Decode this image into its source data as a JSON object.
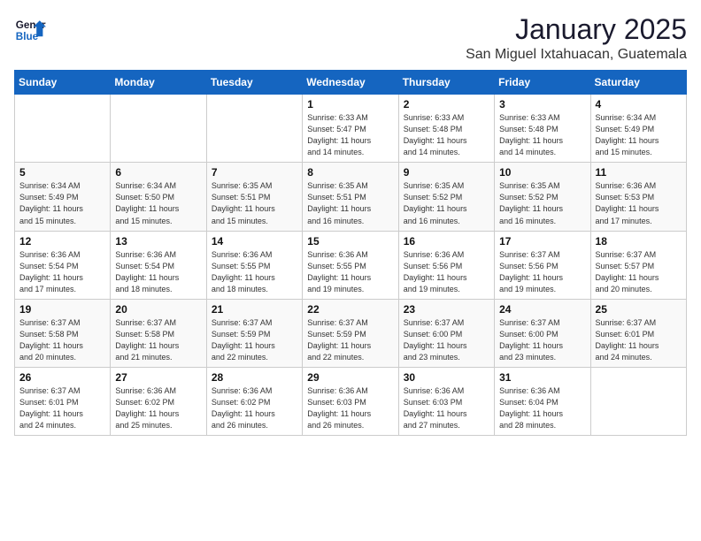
{
  "header": {
    "logo_line1": "General",
    "logo_line2": "Blue",
    "month_year": "January 2025",
    "location": "San Miguel Ixtahuacan, Guatemala"
  },
  "weekdays": [
    "Sunday",
    "Monday",
    "Tuesday",
    "Wednesday",
    "Thursday",
    "Friday",
    "Saturday"
  ],
  "weeks": [
    [
      {
        "day": "",
        "info": ""
      },
      {
        "day": "",
        "info": ""
      },
      {
        "day": "",
        "info": ""
      },
      {
        "day": "1",
        "info": "Sunrise: 6:33 AM\nSunset: 5:47 PM\nDaylight: 11 hours\nand 14 minutes."
      },
      {
        "day": "2",
        "info": "Sunrise: 6:33 AM\nSunset: 5:48 PM\nDaylight: 11 hours\nand 14 minutes."
      },
      {
        "day": "3",
        "info": "Sunrise: 6:33 AM\nSunset: 5:48 PM\nDaylight: 11 hours\nand 14 minutes."
      },
      {
        "day": "4",
        "info": "Sunrise: 6:34 AM\nSunset: 5:49 PM\nDaylight: 11 hours\nand 15 minutes."
      }
    ],
    [
      {
        "day": "5",
        "info": "Sunrise: 6:34 AM\nSunset: 5:49 PM\nDaylight: 11 hours\nand 15 minutes."
      },
      {
        "day": "6",
        "info": "Sunrise: 6:34 AM\nSunset: 5:50 PM\nDaylight: 11 hours\nand 15 minutes."
      },
      {
        "day": "7",
        "info": "Sunrise: 6:35 AM\nSunset: 5:51 PM\nDaylight: 11 hours\nand 15 minutes."
      },
      {
        "day": "8",
        "info": "Sunrise: 6:35 AM\nSunset: 5:51 PM\nDaylight: 11 hours\nand 16 minutes."
      },
      {
        "day": "9",
        "info": "Sunrise: 6:35 AM\nSunset: 5:52 PM\nDaylight: 11 hours\nand 16 minutes."
      },
      {
        "day": "10",
        "info": "Sunrise: 6:35 AM\nSunset: 5:52 PM\nDaylight: 11 hours\nand 16 minutes."
      },
      {
        "day": "11",
        "info": "Sunrise: 6:36 AM\nSunset: 5:53 PM\nDaylight: 11 hours\nand 17 minutes."
      }
    ],
    [
      {
        "day": "12",
        "info": "Sunrise: 6:36 AM\nSunset: 5:54 PM\nDaylight: 11 hours\nand 17 minutes."
      },
      {
        "day": "13",
        "info": "Sunrise: 6:36 AM\nSunset: 5:54 PM\nDaylight: 11 hours\nand 18 minutes."
      },
      {
        "day": "14",
        "info": "Sunrise: 6:36 AM\nSunset: 5:55 PM\nDaylight: 11 hours\nand 18 minutes."
      },
      {
        "day": "15",
        "info": "Sunrise: 6:36 AM\nSunset: 5:55 PM\nDaylight: 11 hours\nand 19 minutes."
      },
      {
        "day": "16",
        "info": "Sunrise: 6:36 AM\nSunset: 5:56 PM\nDaylight: 11 hours\nand 19 minutes."
      },
      {
        "day": "17",
        "info": "Sunrise: 6:37 AM\nSunset: 5:56 PM\nDaylight: 11 hours\nand 19 minutes."
      },
      {
        "day": "18",
        "info": "Sunrise: 6:37 AM\nSunset: 5:57 PM\nDaylight: 11 hours\nand 20 minutes."
      }
    ],
    [
      {
        "day": "19",
        "info": "Sunrise: 6:37 AM\nSunset: 5:58 PM\nDaylight: 11 hours\nand 20 minutes."
      },
      {
        "day": "20",
        "info": "Sunrise: 6:37 AM\nSunset: 5:58 PM\nDaylight: 11 hours\nand 21 minutes."
      },
      {
        "day": "21",
        "info": "Sunrise: 6:37 AM\nSunset: 5:59 PM\nDaylight: 11 hours\nand 22 minutes."
      },
      {
        "day": "22",
        "info": "Sunrise: 6:37 AM\nSunset: 5:59 PM\nDaylight: 11 hours\nand 22 minutes."
      },
      {
        "day": "23",
        "info": "Sunrise: 6:37 AM\nSunset: 6:00 PM\nDaylight: 11 hours\nand 23 minutes."
      },
      {
        "day": "24",
        "info": "Sunrise: 6:37 AM\nSunset: 6:00 PM\nDaylight: 11 hours\nand 23 minutes."
      },
      {
        "day": "25",
        "info": "Sunrise: 6:37 AM\nSunset: 6:01 PM\nDaylight: 11 hours\nand 24 minutes."
      }
    ],
    [
      {
        "day": "26",
        "info": "Sunrise: 6:37 AM\nSunset: 6:01 PM\nDaylight: 11 hours\nand 24 minutes."
      },
      {
        "day": "27",
        "info": "Sunrise: 6:36 AM\nSunset: 6:02 PM\nDaylight: 11 hours\nand 25 minutes."
      },
      {
        "day": "28",
        "info": "Sunrise: 6:36 AM\nSunset: 6:02 PM\nDaylight: 11 hours\nand 26 minutes."
      },
      {
        "day": "29",
        "info": "Sunrise: 6:36 AM\nSunset: 6:03 PM\nDaylight: 11 hours\nand 26 minutes."
      },
      {
        "day": "30",
        "info": "Sunrise: 6:36 AM\nSunset: 6:03 PM\nDaylight: 11 hours\nand 27 minutes."
      },
      {
        "day": "31",
        "info": "Sunrise: 6:36 AM\nSunset: 6:04 PM\nDaylight: 11 hours\nand 28 minutes."
      },
      {
        "day": "",
        "info": ""
      }
    ]
  ]
}
